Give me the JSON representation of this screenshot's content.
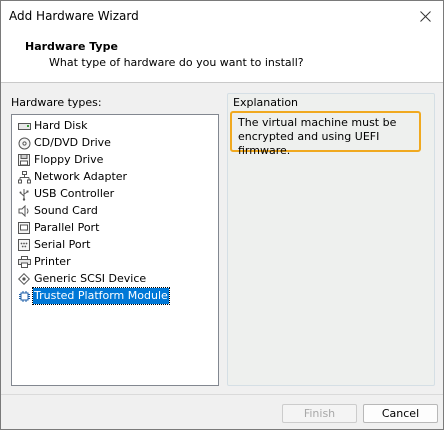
{
  "window": {
    "title": "Add Hardware Wizard"
  },
  "header": {
    "title": "Hardware Type",
    "subtitle": "What type of hardware do you want to install?"
  },
  "hardware": {
    "label": "Hardware types:",
    "items": [
      {
        "label": "Hard Disk",
        "icon": "hard-disk-icon"
      },
      {
        "label": "CD/DVD Drive",
        "icon": "cd-dvd-icon"
      },
      {
        "label": "Floppy Drive",
        "icon": "floppy-icon"
      },
      {
        "label": "Network Adapter",
        "icon": "network-icon"
      },
      {
        "label": "USB Controller",
        "icon": "usb-icon"
      },
      {
        "label": "Sound Card",
        "icon": "speaker-icon"
      },
      {
        "label": "Parallel Port",
        "icon": "parallel-port-icon"
      },
      {
        "label": "Serial Port",
        "icon": "serial-port-icon"
      },
      {
        "label": "Printer",
        "icon": "printer-icon"
      },
      {
        "label": "Generic SCSI Device",
        "icon": "scsi-icon"
      },
      {
        "label": "Trusted Platform Module",
        "icon": "tpm-chip-icon"
      }
    ],
    "selected": "Trusted Platform Module"
  },
  "explanation": {
    "label": "Explanation",
    "text": "The virtual machine must be encrypted and using UEFI firmware.",
    "highlight_color": "#f0a91f"
  },
  "buttons": {
    "finish": "Finish",
    "cancel": "Cancel"
  },
  "colors": {
    "selection": "#0078d7"
  }
}
